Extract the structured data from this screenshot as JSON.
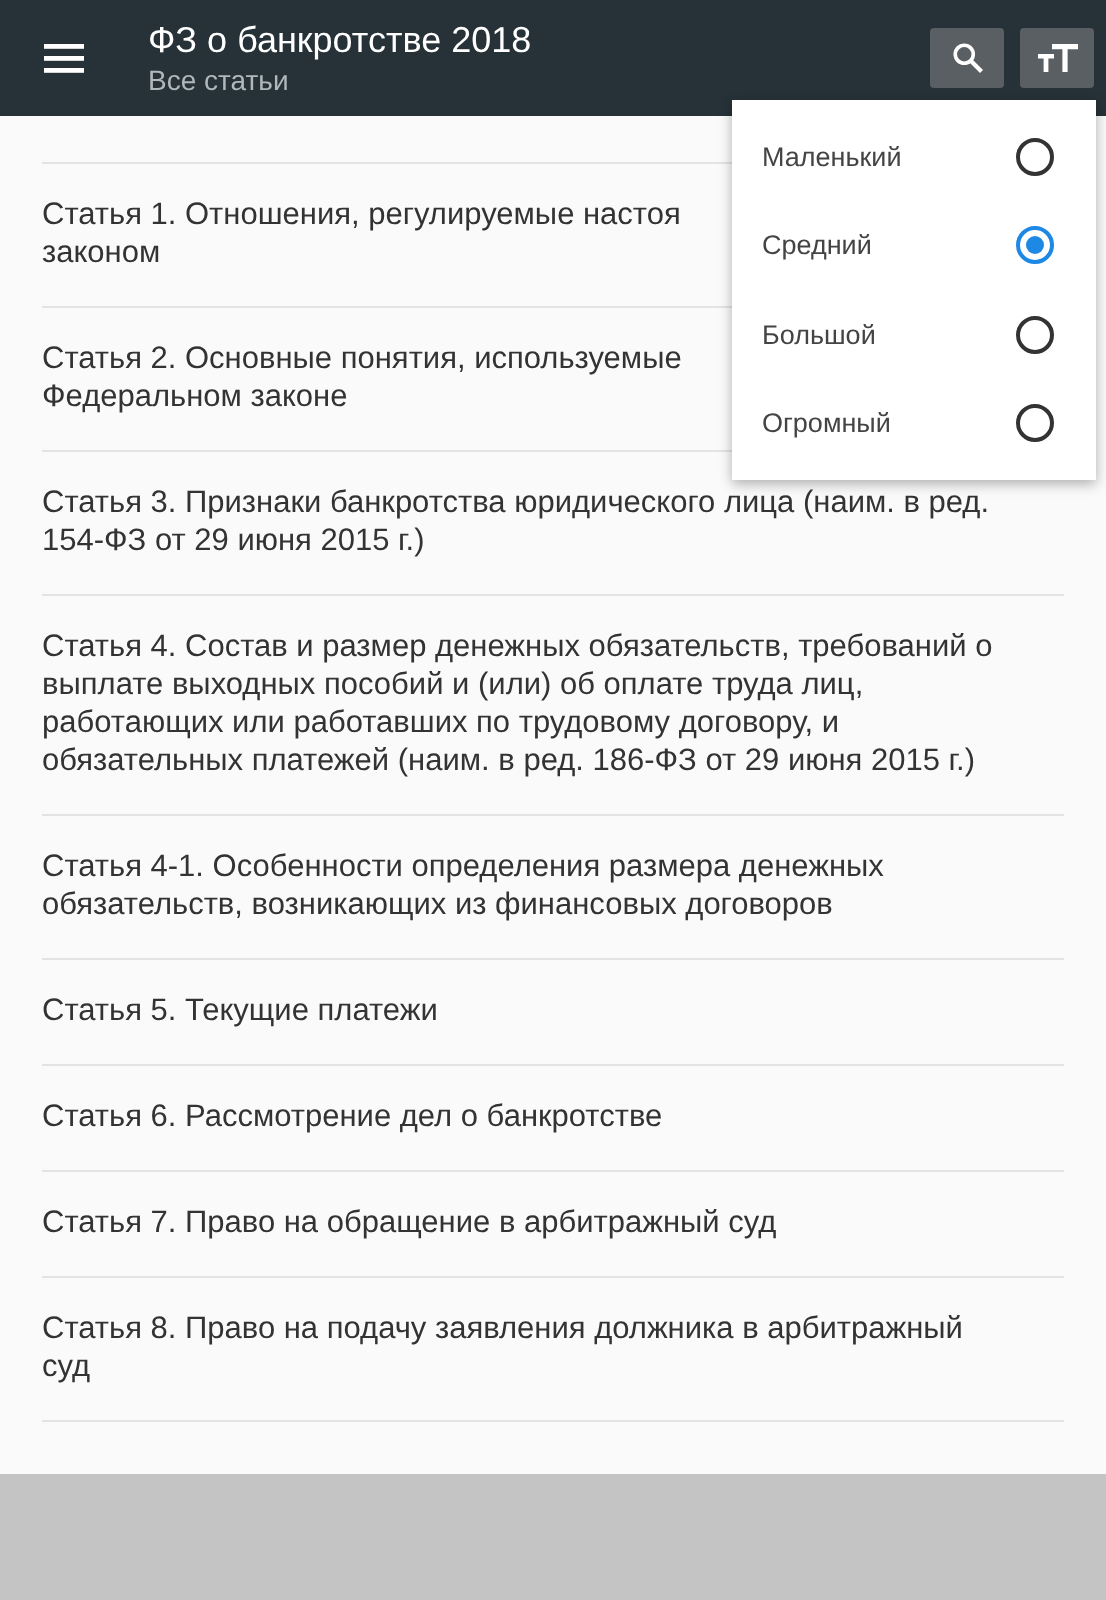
{
  "app_bar": {
    "title": "ФЗ о банкротстве 2018",
    "subtitle": "Все статьи"
  },
  "articles": [
    {
      "title": "Статья 1. Отношения, регулируемые настоя\nзаконом"
    },
    {
      "title": "Статья 2. Основные понятия, используемые\nФедеральном законе"
    },
    {
      "title": "Статья 3. Признаки банкротства юридического лица (наим. в ред. 154-ФЗ от 29 июня 2015 г.)"
    },
    {
      "title": "Статья 4. Состав и размер денежных обязательств, требований о выплате выходных пособий и (или) об оплате труда лиц, работающих или работавших по трудовому договору, и обязательных платежей (наим. в ред. 186-ФЗ от 29 июня 2015 г.)"
    },
    {
      "title": "Статья 4-1. Особенности определения размера денежных обязательств, возникающих из финансовых договоров"
    },
    {
      "title": "Статья 5. Текущие платежи"
    },
    {
      "title": "Статья 6. Рассмотрение дел о банкротстве"
    },
    {
      "title": "Статья 7. Право на обращение в арбитражный суд"
    },
    {
      "title": "Статья 8. Право на подачу заявления должника в арбитражный суд"
    }
  ],
  "font_size_menu": [
    {
      "label": "Маленький",
      "selected": false
    },
    {
      "label": "Средний",
      "selected": true
    },
    {
      "label": "Большой",
      "selected": false
    },
    {
      "label": "Огромный",
      "selected": false
    }
  ]
}
